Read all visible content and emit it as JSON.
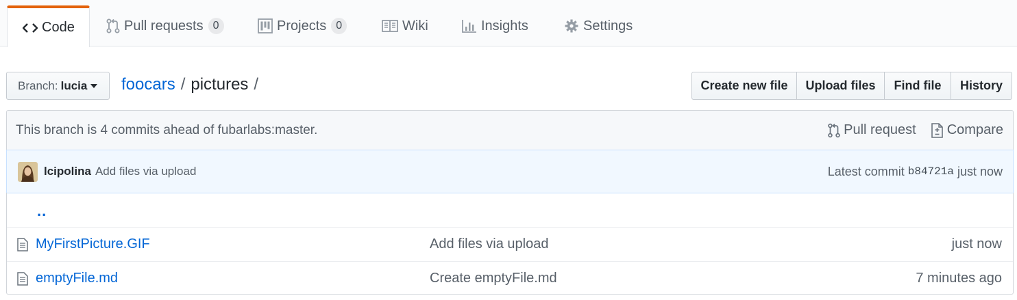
{
  "tabs": [
    {
      "label": "Code",
      "icon": "code-icon"
    },
    {
      "label": "Pull requests",
      "icon": "git-pull-request-icon",
      "count": "0"
    },
    {
      "label": "Projects",
      "icon": "project-icon",
      "count": "0"
    },
    {
      "label": "Wiki",
      "icon": "book-icon"
    },
    {
      "label": "Insights",
      "icon": "graph-icon"
    },
    {
      "label": "Settings",
      "icon": "gear-icon"
    }
  ],
  "branch": {
    "prefix": "Branch:",
    "name": "lucia"
  },
  "breadcrumb": {
    "repo": "foocars",
    "sep": "/",
    "dir": "pictures",
    "trailing": "/"
  },
  "actions": {
    "create": "Create new file",
    "upload": "Upload files",
    "find": "Find file",
    "history": "History"
  },
  "branch_info": {
    "text": "This branch is 4 commits ahead of fubarlabs:master.",
    "pull_request": "Pull request",
    "compare": "Compare"
  },
  "commit": {
    "author": "lcipolina",
    "message": "Add files via upload",
    "latest_label": "Latest commit",
    "sha": "b84721a",
    "time": "just now"
  },
  "files": {
    "up": "..",
    "rows": [
      {
        "name": "MyFirstPicture.GIF",
        "message": "Add files via upload",
        "age": "just now"
      },
      {
        "name": "emptyFile.md",
        "message": "Create emptyFile.md",
        "age": "7 minutes ago"
      }
    ]
  },
  "colors": {
    "link": "#0366d6",
    "tab_accent": "#e36209",
    "commit_bg": "#f1f8ff"
  }
}
